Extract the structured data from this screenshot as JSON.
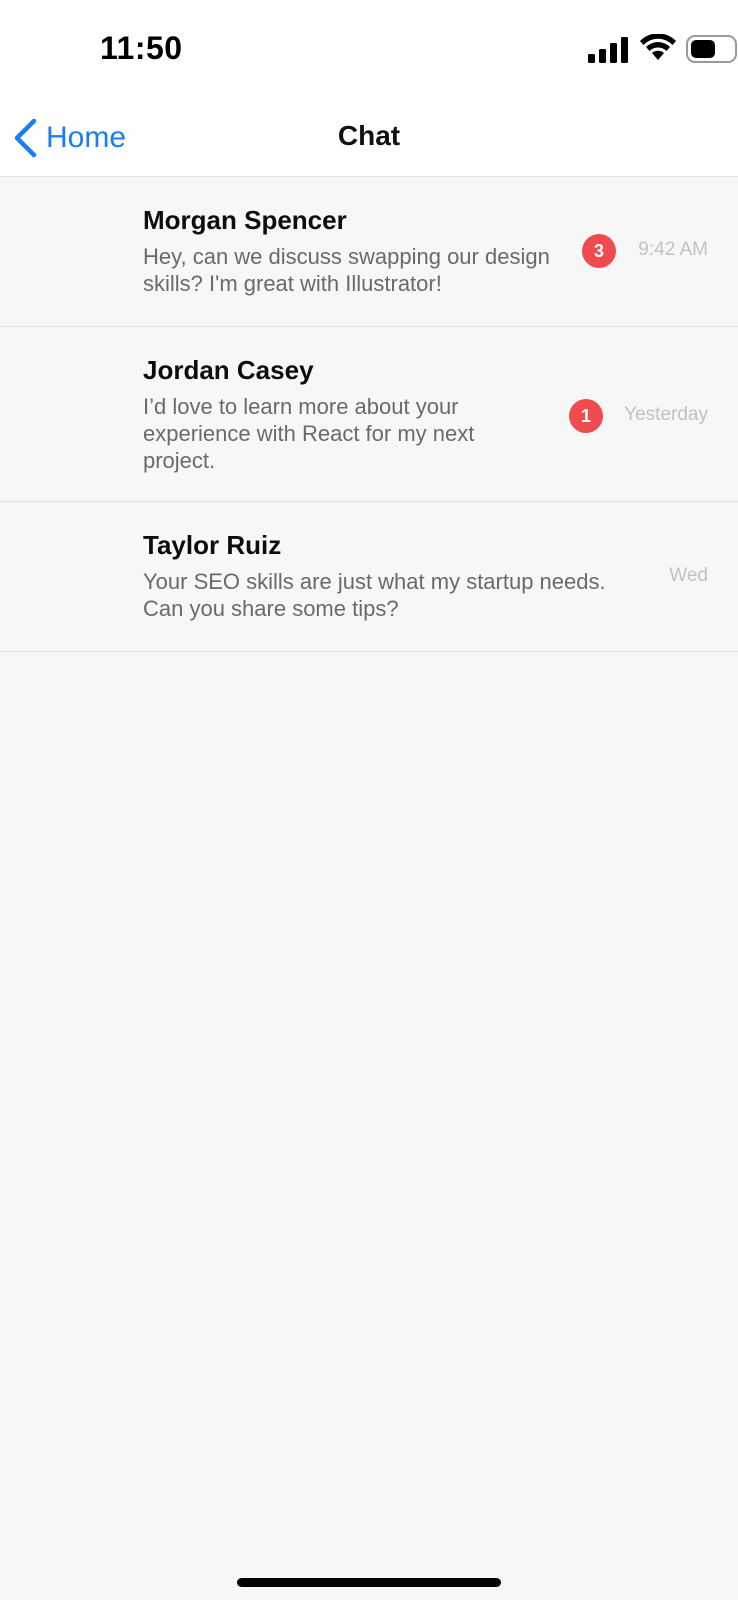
{
  "status_bar": {
    "time": "11:50",
    "icons": [
      "signal-icon",
      "wifi-icon",
      "battery-icon"
    ]
  },
  "nav": {
    "back_label": "Home",
    "title": "Chat",
    "accent_color": "#1a7ef0"
  },
  "chats": [
    {
      "name": "Morgan Spencer",
      "preview": "Hey, can we discuss swapping our design skills? I'm great with Illustrator!",
      "unread": "3",
      "time": "9:42 AM"
    },
    {
      "name": "Jordan Casey",
      "preview": "I’d love to learn more about your experience with React for my next project.",
      "unread": "1",
      "time": "Yesterday"
    },
    {
      "name": "Taylor Ruiz",
      "preview": "Your SEO skills are just what my startup needs. Can you share some tips?",
      "unread": "",
      "time": "Wed"
    }
  ],
  "colors": {
    "badge": "#f04b4f",
    "background": "#f7f7f7"
  }
}
